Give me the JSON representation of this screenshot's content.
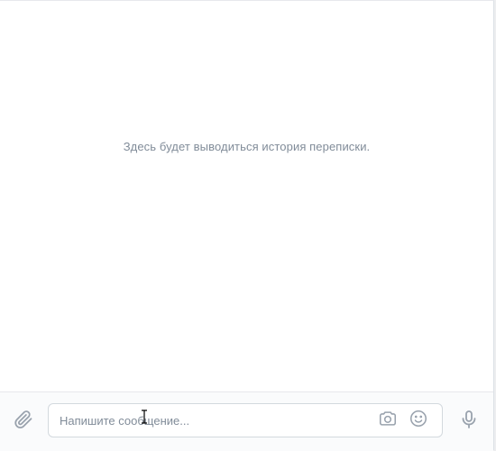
{
  "history": {
    "empty_text": "Здесь будет выводиться история переписки."
  },
  "composer": {
    "placeholder": "Напишите сообщение...",
    "value": "",
    "attach_icon": "paperclip-icon",
    "camera_icon": "camera-icon",
    "emoji_icon": "smile-icon",
    "mic_icon": "microphone-icon"
  },
  "colors": {
    "icon": "#99a2ad",
    "placeholder": "#818c99",
    "border": "#d3d9de",
    "composer_bg": "#fafbfc"
  }
}
